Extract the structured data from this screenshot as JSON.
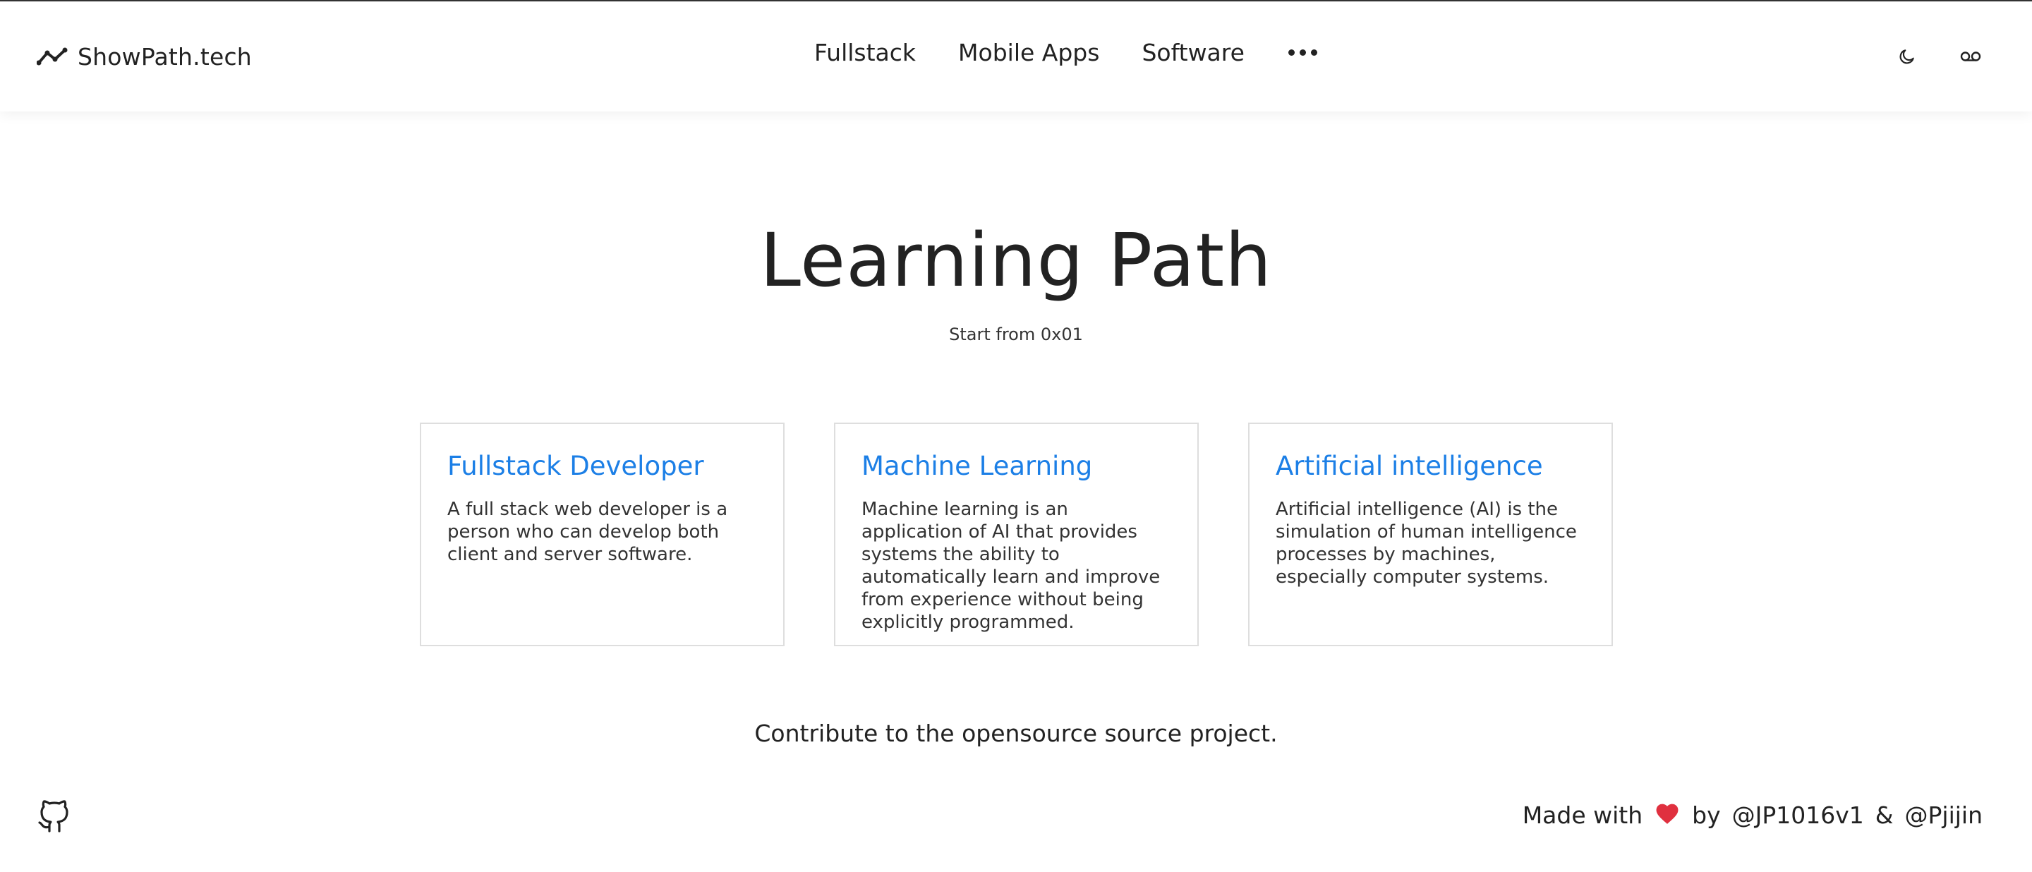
{
  "header": {
    "brand": "ShowPath.tech",
    "nav": [
      "Fullstack",
      "Mobile Apps",
      "Software"
    ]
  },
  "hero": {
    "title": "Learning Path",
    "subtitle": "Start from 0x01"
  },
  "cards": [
    {
      "title": "Fullstack Developer",
      "description": "A full stack web developer is a person who can develop both client and server software."
    },
    {
      "title": "Machine Learning",
      "description": "Machine learning is an application of AI that provides systems the ability to automatically learn and improve from experience without being explicitly programmed."
    },
    {
      "title": "Artificial intelligence",
      "description": "Artificial intelligence (AI) is the simulation of human intelligence processes by machines, especially computer systems."
    }
  ],
  "contribute": "Contribute to the opensource source project.",
  "footer": {
    "made_with": "Made with",
    "by": "by",
    "author1": "@JP1016v1",
    "amp": "&",
    "author2": "@Pjijin"
  },
  "colors": {
    "accent": "#1c7fe6",
    "heart": "#e0303f",
    "text": "#222222",
    "card_border": "#dedede"
  },
  "icons": {
    "brand": "trending-line-icon",
    "more": "more-horizontal-icon",
    "theme": "moon-icon",
    "voicemail": "voicemail-icon",
    "github": "github-icon",
    "heart": "heart-icon"
  }
}
